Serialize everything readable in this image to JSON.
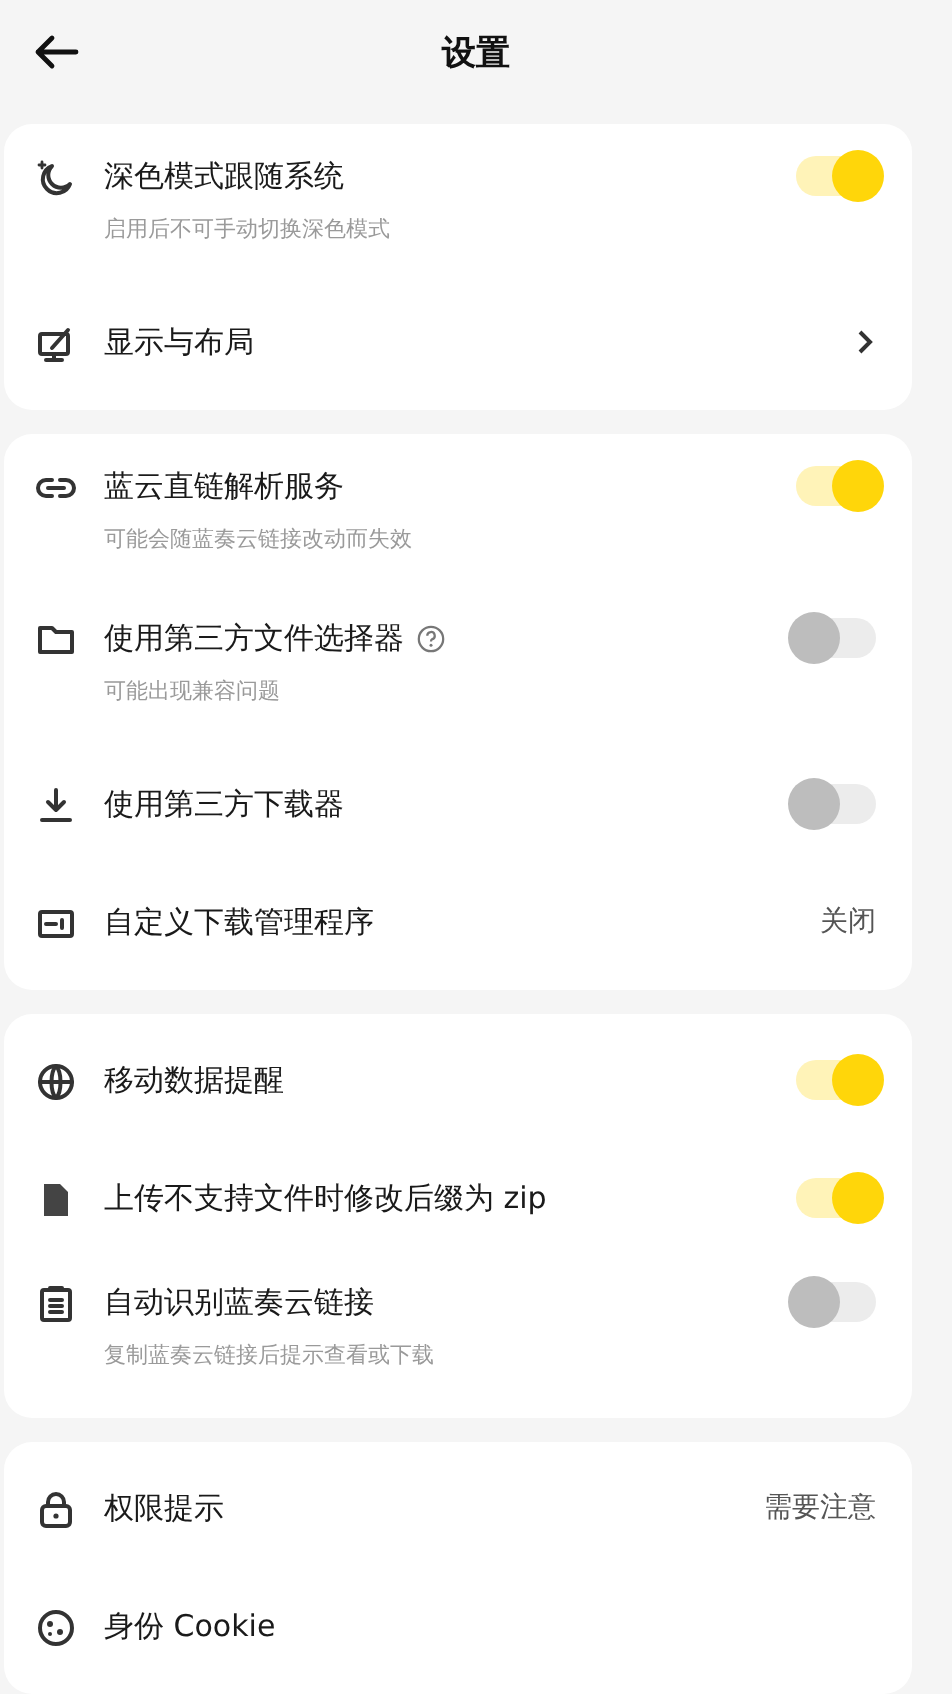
{
  "header": {
    "title": "设置"
  },
  "sections": [
    {
      "items": [
        {
          "kind": "toggle",
          "title": "深色模式跟随系统",
          "subtitle": "启用后不可手动切换深色模式",
          "on": true
        },
        {
          "kind": "nav",
          "title": "显示与布局"
        }
      ]
    },
    {
      "items": [
        {
          "kind": "toggle",
          "title": "蓝云直链解析服务",
          "subtitle": "可能会随蓝奏云链接改动而失效",
          "on": true
        },
        {
          "kind": "toggle",
          "title": "使用第三方文件选择器",
          "subtitle": "可能出现兼容问题",
          "on": false,
          "help": true
        },
        {
          "kind": "toggle",
          "title": "使用第三方下载器",
          "on": false
        },
        {
          "kind": "value",
          "title": "自定义下载管理程序",
          "value": "关闭"
        }
      ]
    },
    {
      "items": [
        {
          "kind": "toggle",
          "title": "移动数据提醒",
          "on": true
        },
        {
          "kind": "toggle",
          "title": "上传不支持文件时修改后缀为 zip",
          "on": true
        },
        {
          "kind": "toggle",
          "title": "自动识别蓝奏云链接",
          "subtitle": "复制蓝奏云链接后提示查看或下载",
          "on": false
        }
      ]
    },
    {
      "items": [
        {
          "kind": "value",
          "title": "权限提示",
          "value": "需要注意"
        },
        {
          "kind": "plain",
          "title": "身份 Cookie"
        }
      ]
    }
  ]
}
